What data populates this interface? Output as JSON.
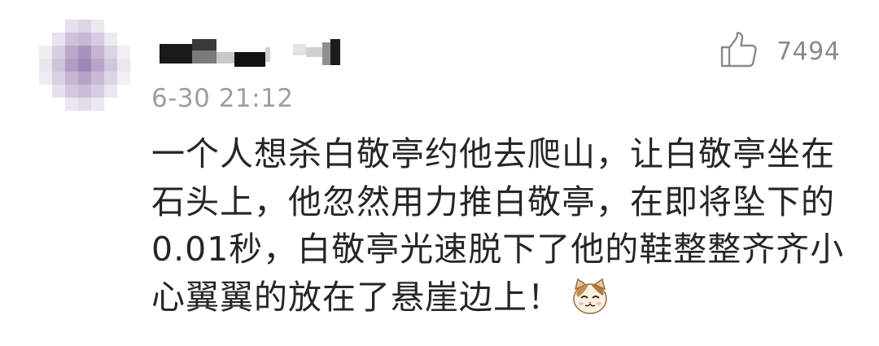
{
  "comment": {
    "timestamp": "6-30 21:12",
    "like_count": "7494",
    "content_lines": [
      "一个人想杀白敬亭约他去爬山，让白敬亭坐在",
      "石头上，他忽然用力推白敬亭，在即将坠下的",
      "0.01秒，白敬亭光速脱下了他的鞋整整齐齐小",
      "心翼翼的放在了悬崖边上！"
    ],
    "emoji": "cat-face-emoji"
  },
  "colors": {
    "text": "#262626",
    "meta": "#9e9e9e",
    "icon": "#8a8a8a",
    "background": "#ffffff"
  }
}
